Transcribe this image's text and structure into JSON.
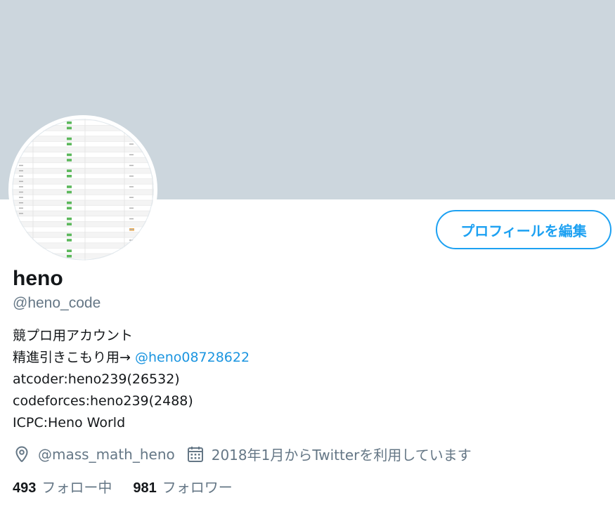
{
  "profile": {
    "display_name": "heno",
    "handle": "@heno_code",
    "edit_button_label": "プロフィールを編集",
    "bio": {
      "line1": "競プロ用アカウント",
      "line2_text": "精進引きこもり用→ ",
      "line2_link": "@heno08728622",
      "line3": "atcoder:heno239(26532)",
      "line4": "codeforces:heno239(2488)",
      "line5": "ICPC:Heno World"
    },
    "location": "@mass_math_heno",
    "joined": "2018年1月からTwitterを利用しています",
    "following_count": "493",
    "following_label": "フォロー中",
    "followers_count": "981",
    "followers_label": "フォロワー"
  },
  "icons": {
    "location": "location-pin-icon",
    "joined": "calendar-icon"
  },
  "colors": {
    "banner": "#ccd6dd",
    "accent": "#1da1f2",
    "link": "#1b95e0",
    "secondary_text": "#657786",
    "primary_text": "#14171a"
  }
}
